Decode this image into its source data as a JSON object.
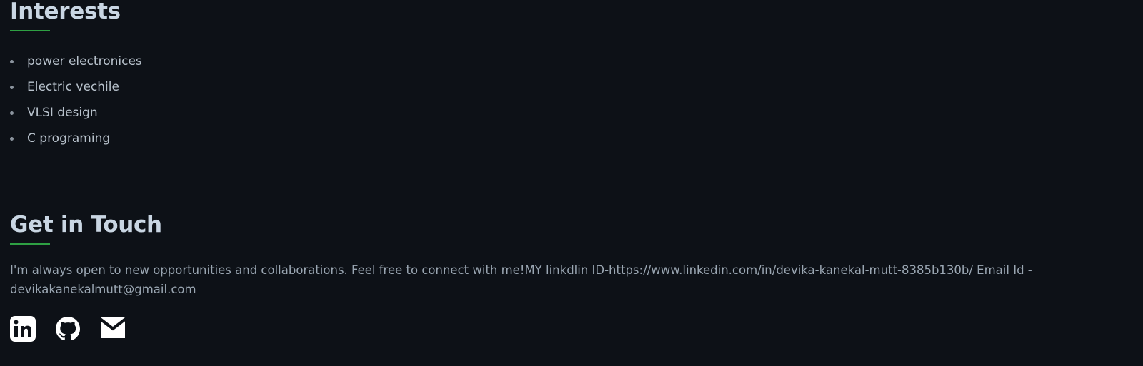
{
  "interests": {
    "title": "Interests",
    "items": [
      {
        "label": "power electronices"
      },
      {
        "label": "Electric vechile"
      },
      {
        "label": "VLSI design"
      },
      {
        "label": "C programing"
      }
    ]
  },
  "contact": {
    "title": "Get in Touch",
    "line1": "I'm always open to new opportunities and collaborations. Feel free to connect with me!MY linkdlin ID-https://www.linkedin.com/in/devika-kanekal-mutt-8385b130b/ Email Id -",
    "line2": "devikakanekalmutt@gmail.com",
    "social": [
      {
        "icon": "linkedin-icon"
      },
      {
        "icon": "github-icon"
      },
      {
        "icon": "email-icon"
      }
    ]
  },
  "colors": {
    "background": "#0d1117",
    "accent": "#2ea043",
    "heading": "#c9d6e3",
    "text": "#9aa6b2",
    "icon": "#ffffff"
  }
}
